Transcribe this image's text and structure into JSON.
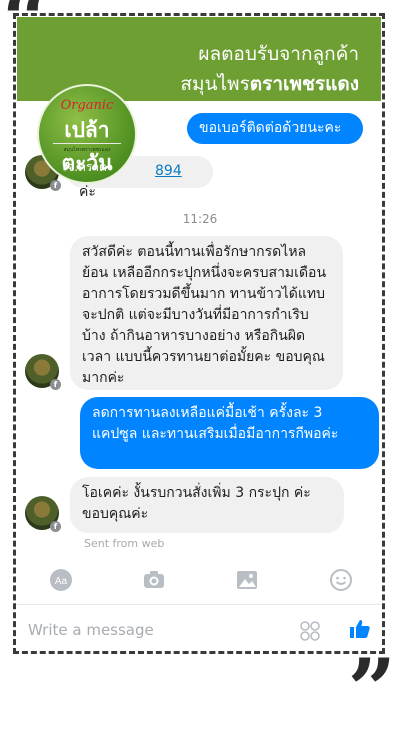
{
  "banner": {
    "line1": "ผลตอบรับจากลูกค้า",
    "line2_prefix": "สมุนไพร",
    "line2_bold": "ตราเพชรแดง"
  },
  "logo": {
    "organic": "Organic",
    "brand": "เปล้าตะวัน",
    "tagline": "สมุนไพรตราเพชรแดง",
    "province": "จ.ตราด"
  },
  "messages": [
    {
      "id": "out1",
      "text": "ขอเบอร์ติดต่อด้วยนะคะ"
    },
    {
      "id": "in1",
      "phone_part": "894",
      "suffix": "ค่ะ"
    },
    {
      "id": "in2",
      "text": "สวัสดีค่ะ ตอนนี้ทานเพื่อรักษากรดไหลย้อน เหลืออีกกระปุกหนึ่งจะครบสามเดือน อาการโดยรวมดีขึ้นมาก ทานข้าวได้แทบจะปกติ แต่จะมีบางวันที่มีอาการกำเริบบ้าง ถ้ากินอาหารบางอย่าง หรือกินผิดเวลา แบบนี้ควรทานยาต่อมั้ยคะ ขอบคุณมากค่ะ"
    },
    {
      "id": "out2",
      "text": "ลดการทานลงเหลือแค่มื้อเช้า ครั้งละ 3 แคปซูล และทานเสริมเมื่อมีอาการกีพอค่ะ"
    },
    {
      "id": "in3",
      "text": "โอเคค่ะ งั้นรบกวนสั่งเพิ่ม 3 กระปุก ค่ะ ขอบคุณค่ะ"
    }
  ],
  "timestamp": "11:26",
  "sent_from": "Sent from web",
  "composer": {
    "placeholder": "Write a message",
    "icons": [
      "text-style-icon",
      "camera-icon",
      "image-icon",
      "emoji-icon",
      "sticker-grid-icon",
      "thumbs-up-icon"
    ]
  },
  "colors": {
    "banner": "#6e9f33",
    "outgoing": "#0084ff",
    "incoming": "#f1f0f0"
  }
}
